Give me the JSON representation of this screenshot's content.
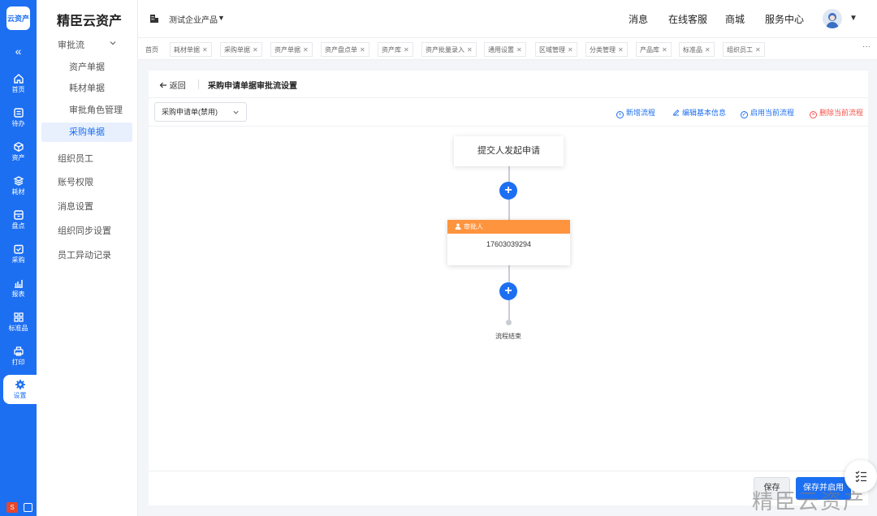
{
  "app": {
    "badge": "云资产",
    "brand": "精臣云资产",
    "collapse": "«"
  },
  "rail": [
    {
      "label": "首页",
      "icon": "home-icon"
    },
    {
      "label": "待办",
      "icon": "todo-icon"
    },
    {
      "label": "资产",
      "icon": "cube-icon"
    },
    {
      "label": "耗材",
      "icon": "layers-icon"
    },
    {
      "label": "盘点",
      "icon": "inventory-icon"
    },
    {
      "label": "采购",
      "icon": "purchase-icon"
    },
    {
      "label": "报表",
      "icon": "chart-icon"
    },
    {
      "label": "标准品",
      "icon": "grid-icon"
    },
    {
      "label": "打印",
      "icon": "printer-icon"
    },
    {
      "label": "设置",
      "icon": "gear-icon"
    }
  ],
  "sidebar": {
    "group": "审批流",
    "sub": [
      "资产单据",
      "耗材单据",
      "审批角色管理",
      "采购单据"
    ],
    "items": [
      "组织员工",
      "账号权限",
      "消息设置",
      "组织同步设置",
      "员工异动记录"
    ]
  },
  "header": {
    "company": "测试企业产品",
    "links": [
      "消息",
      "在线客服",
      "商城",
      "服务中心"
    ]
  },
  "tabs": [
    "首页",
    "耗材单据",
    "采购单据",
    "资产单据",
    "资产盘点单",
    "资产库",
    "资产批量录入",
    "通用设置",
    "区域管理",
    "分类管理",
    "产品库",
    "标准品",
    "组织员工"
  ],
  "tabs_more": "···",
  "page": {
    "back": "返回",
    "title": "采购申请单据审批流设置",
    "select_value": "采购申请单(禁用)",
    "actions": [
      "新增流程",
      "编辑基本信息",
      "启用当前流程",
      "删除当前流程"
    ]
  },
  "flow": {
    "start": "提交人发起申请",
    "approver_title": "审批人",
    "approver_value": "17603039294",
    "end": "流程结束"
  },
  "buttons": {
    "save": "保存",
    "save_enable": "保存并启用"
  },
  "watermark": "精臣云资产",
  "colors": {
    "primary": "#1d6ff2",
    "approver_header": "#ff943e",
    "danger": "#f5544d"
  }
}
